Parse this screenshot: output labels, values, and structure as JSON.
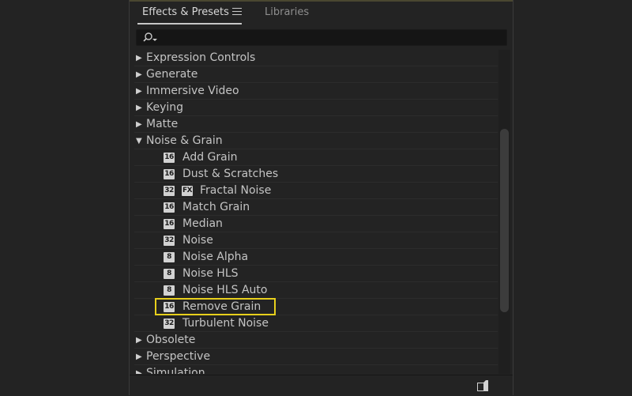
{
  "tabs": [
    {
      "label": "Effects & Presets",
      "active": true
    },
    {
      "label": "Libraries",
      "active": false
    }
  ],
  "search": {
    "value": "",
    "placeholder": ""
  },
  "accent": {
    "highlight": "#e7cf1c"
  },
  "tree": [
    {
      "kind": "category",
      "expanded": false,
      "label": "Expression Controls"
    },
    {
      "kind": "category",
      "expanded": false,
      "label": "Generate"
    },
    {
      "kind": "category",
      "expanded": false,
      "label": "Immersive Video"
    },
    {
      "kind": "category",
      "expanded": false,
      "label": "Keying"
    },
    {
      "kind": "category",
      "expanded": false,
      "label": "Matte"
    },
    {
      "kind": "category",
      "expanded": true,
      "label": "Noise & Grain"
    },
    {
      "kind": "effect",
      "bpc": "16",
      "label": "Add Grain"
    },
    {
      "kind": "effect",
      "bpc": "16",
      "label": "Dust & Scratches"
    },
    {
      "kind": "effect",
      "bpc": "32",
      "fx": "FX",
      "label": "Fractal Noise"
    },
    {
      "kind": "effect",
      "bpc": "16",
      "label": "Match Grain"
    },
    {
      "kind": "effect",
      "bpc": "16",
      "label": "Median"
    },
    {
      "kind": "effect",
      "bpc": "32",
      "label": "Noise"
    },
    {
      "kind": "effect",
      "bpc": "8",
      "label": "Noise Alpha"
    },
    {
      "kind": "effect",
      "bpc": "8",
      "label": "Noise HLS"
    },
    {
      "kind": "effect",
      "bpc": "8",
      "label": "Noise HLS Auto"
    },
    {
      "kind": "effect",
      "bpc": "16",
      "label": "Remove Grain",
      "highlighted": true
    },
    {
      "kind": "effect",
      "bpc": "32",
      "label": "Turbulent Noise"
    },
    {
      "kind": "category",
      "expanded": false,
      "label": "Obsolete"
    },
    {
      "kind": "category",
      "expanded": false,
      "label": "Perspective"
    },
    {
      "kind": "category",
      "expanded": false,
      "label": "Simulation"
    }
  ]
}
